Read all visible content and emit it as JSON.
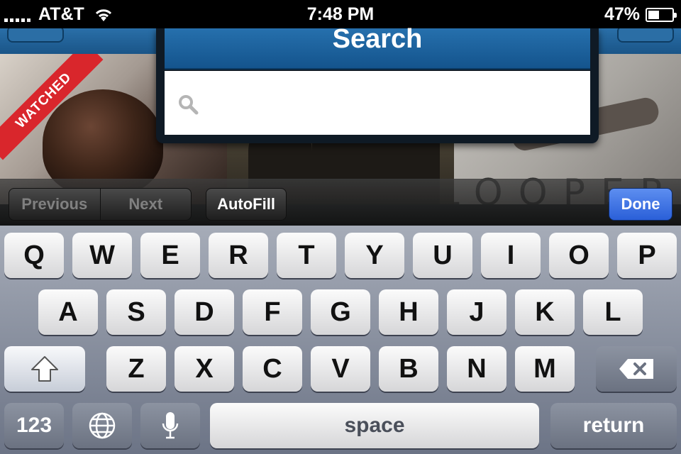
{
  "status_bar": {
    "carrier": "AT&T",
    "time": "7:48 PM",
    "battery_percent": "47%",
    "battery_level": 0.47,
    "signal_bars": 4,
    "wifi": true
  },
  "background": {
    "tiles": [
      {
        "badge": "WATCHED"
      },
      {},
      {
        "poster_text": "LOOPER"
      }
    ]
  },
  "search_popup": {
    "title": "Search",
    "placeholder": "",
    "value": ""
  },
  "keyboard_toolbar": {
    "previous": "Previous",
    "next": "Next",
    "autofill": "AutoFill",
    "done": "Done"
  },
  "keyboard": {
    "row1": [
      "Q",
      "W",
      "E",
      "R",
      "T",
      "Y",
      "U",
      "I",
      "O",
      "P"
    ],
    "row2": [
      "A",
      "S",
      "D",
      "F",
      "G",
      "H",
      "J",
      "K",
      "L"
    ],
    "row3": [
      "Z",
      "X",
      "C",
      "V",
      "B",
      "N",
      "M"
    ],
    "numbers_key": "123",
    "space_key": "space",
    "return_key": "return",
    "icons": {
      "shift": "shift-icon",
      "delete": "delete-icon",
      "globe": "globe-icon",
      "mic": "microphone-icon"
    }
  },
  "colors": {
    "nav_blue": "#1a5588",
    "done_blue": "#2a5fd8",
    "watched_red": "#d9262c"
  }
}
